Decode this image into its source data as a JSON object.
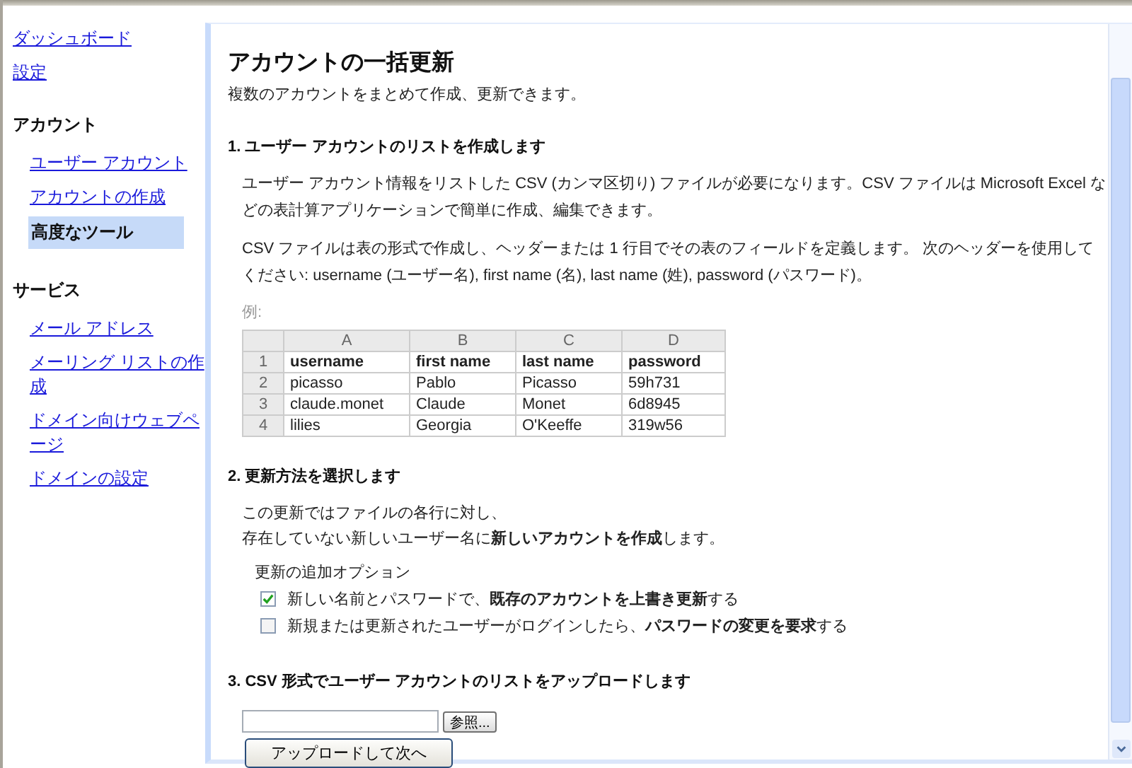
{
  "sidebar": {
    "top_links": [
      "ダッシュボード",
      "設定"
    ],
    "sections": [
      {
        "title": "アカウント",
        "items": [
          {
            "label": "ユーザー アカウント",
            "selected": false
          },
          {
            "label": "アカウントの作成",
            "selected": false
          },
          {
            "label": "高度なツール",
            "selected": true
          }
        ]
      },
      {
        "title": "サービス",
        "items": [
          {
            "label": "メール アドレス",
            "selected": false
          },
          {
            "label": "メーリング リストの作成",
            "selected": false
          },
          {
            "label": "ドメイン向けウェブページ",
            "selected": false
          },
          {
            "label": "ドメインの設定",
            "selected": false
          }
        ]
      }
    ]
  },
  "main": {
    "title": "アカウントの一括更新",
    "subtitle": "複数のアカウントをまとめて作成、更新できます。",
    "step1": {
      "heading": "1. ユーザー アカウントのリストを作成します",
      "paragraphs": [
        "ユーザー アカウント情報をリストした CSV (カンマ区切り) ファイルが必要になります。CSV ファイルは Microsoft Excel などの表計算アプリケーションで簡単に作成、編集できます。",
        "CSV ファイルは表の形式で作成し、ヘッダーまたは 1 行目でその表のフィールドを定義します。 次のヘッダーを使用してください: username (ユーザー名), first name (名), last name (姓), password (パスワード)。"
      ],
      "example_label": "例:",
      "table": {
        "columns": [
          "A",
          "B",
          "C",
          "D"
        ],
        "rows": [
          {
            "number": "1",
            "kind": "header",
            "cells": [
              "username",
              "first name",
              "last name",
              "password"
            ]
          },
          {
            "number": "2",
            "kind": "data",
            "cells": [
              "picasso",
              "Pablo",
              "Picasso",
              "59h731"
            ]
          },
          {
            "number": "3",
            "kind": "data",
            "cells": [
              "claude.monet",
              "Claude",
              "Monet",
              "6d8945"
            ]
          },
          {
            "number": "4",
            "kind": "data",
            "cells": [
              "lilies",
              "Georgia",
              "O'Keeffe",
              "319w56"
            ]
          }
        ]
      }
    },
    "step2": {
      "heading": "2. 更新方法を選択します",
      "lines": [
        "この更新ではファイルの各行に対し、",
        "存在していない新しいユーザー名に**新しいアカウントを作成**します。"
      ],
      "options_label": "更新の追加オプション",
      "options": [
        {
          "label": "新しい名前とパスワードで、**既存のアカウントを上書き更新**する",
          "checked": true
        },
        {
          "label": "新規または更新されたユーザーがログインしたら、**パスワードの変更を要求**する",
          "checked": false
        }
      ]
    },
    "step3": {
      "heading": "3. CSV 形式でユーザー アカウントのリストをアップロードします",
      "browse_button": "参照...",
      "submit_button": "アップロードして次へ"
    }
  }
}
